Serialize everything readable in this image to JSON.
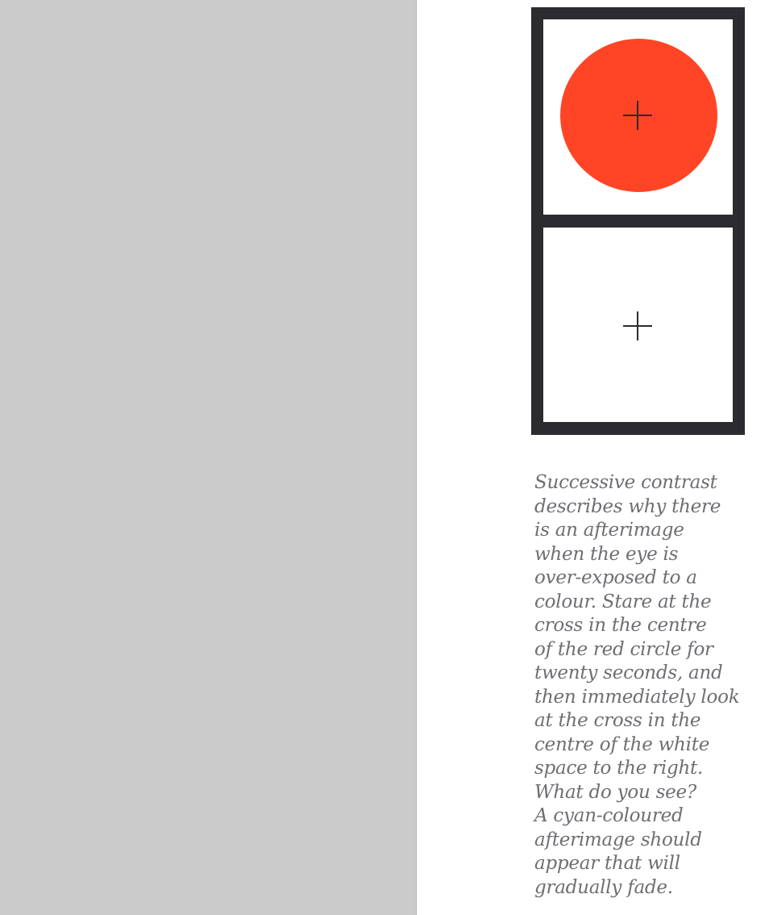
{
  "colors": {
    "left_panel": "#cbcbcb",
    "frame": "#2b2b30",
    "red_circle": "#ff4525",
    "caption_text": "#6e6e73"
  },
  "figure": {
    "top_panel_icon": "cross-icon",
    "bottom_panel_icon": "cross-icon"
  },
  "caption": {
    "lines": [
      "Successive contrast",
      "describes why there",
      "is an afterimage",
      "when the eye is",
      "over-exposed to a",
      "colour. Stare at the",
      "cross in the centre",
      "of the red circle for",
      "twenty seconds, and",
      "then immediately look",
      "at the cross in the",
      "centre of the white",
      "space to the right.",
      "What do you see?",
      "A cyan-coloured",
      "afterimage should",
      "appear that will",
      "gradually fade."
    ]
  }
}
